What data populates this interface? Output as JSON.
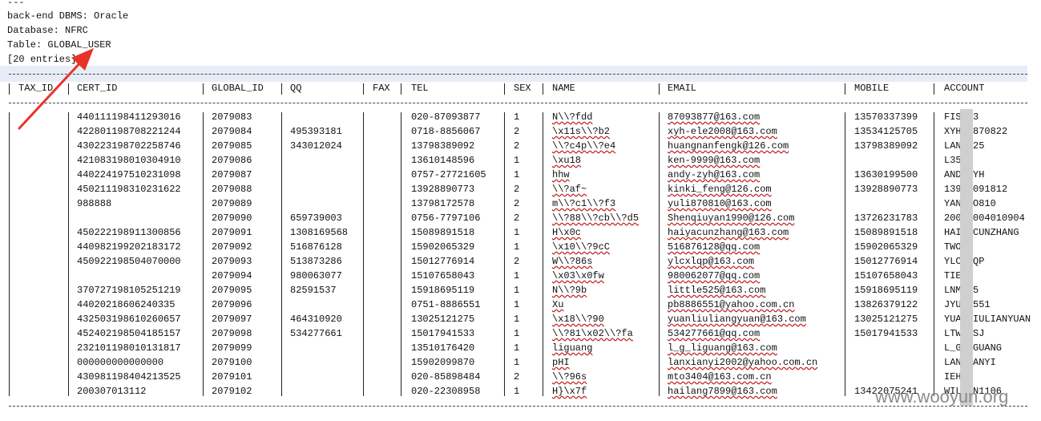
{
  "header": {
    "lines": [
      "---",
      "back-end DBMS: Oracle",
      "Database: NFRC",
      "Table: GLOBAL_USER",
      "[20 entries]"
    ]
  },
  "table": {
    "columns": [
      "TAX_ID",
      "CERT_ID",
      "GLOBAL_ID",
      "QQ",
      "FAX",
      "TEL",
      "SEX",
      "NAME",
      "EMAIL",
      "MOBILE",
      "ACCOUNT"
    ],
    "rows": [
      [
        "",
        "440111198411293016",
        "2079083",
        "",
        "",
        "020-87093877",
        "1",
        "N\\\\?fdd",
        "87093877@163.com",
        "13570337399",
        "FIS123"
      ],
      [
        "",
        "422801198708221244",
        "2079084",
        "495393181",
        "",
        "0718-8856067",
        "2",
        "\\x11s\\\\?b2",
        "xyh-ele2008@163.com",
        "13534125705",
        "XYH19870822"
      ],
      [
        "",
        "430223198702258746",
        "2079085",
        "343012024",
        "",
        "13798389092",
        "2",
        "\\\\?c4p\\\\?e4",
        "huangnanfengk@126.com",
        "13798389092",
        "LANC025"
      ],
      [
        "",
        "421083198010304910",
        "2079086",
        "",
        "",
        "13610148596",
        "1",
        "\\xu18",
        "ken-9999@163.com",
        "",
        "L3510"
      ],
      [
        "",
        "440224197510231098",
        "2079087",
        "",
        "",
        "0757-27721605",
        "1",
        "hhw",
        "andy-zyh@163.com",
        "13630199500",
        "ANDYZYH"
      ],
      [
        "",
        "450211198310231622",
        "2079088",
        "",
        "",
        "13928890773",
        "2",
        "\\\\?af~",
        "kinki_feng@126.com",
        "13928890773",
        "13911091812"
      ],
      [
        "",
        "988888",
        "2079089",
        "",
        "",
        "13798172578",
        "2",
        "m\\\\?c1\\\\?f3",
        "yuli870810@163.com",
        "",
        "YANGUO810"
      ],
      [
        "",
        "",
        "2079090",
        "659739003",
        "",
        "0756-7797106",
        "2",
        "\\\\?88\\\\?cb\\\\?d5",
        "Shenqiuyan1990@126.com",
        "13726231783",
        "20090004010904"
      ],
      [
        "",
        "450222198911300856",
        "2079091",
        "1308169568",
        "",
        "15089891518",
        "1",
        "H\\x0c",
        "haiyacunzhang@163.com",
        "15089891518",
        "HAIYACUNZHANG"
      ],
      [
        "",
        "440982199202183172",
        "2079092",
        "516876128",
        "",
        "15902065329",
        "1",
        "\\x10\\\\?9cC",
        "516876128@qq.com",
        "15902065329",
        "TWO28"
      ],
      [
        "",
        "450922198504070000",
        "2079093",
        "513873286",
        "",
        "15012776914",
        "2",
        "W\\\\?86s",
        "ylcxlqp@163.com",
        "15012776914",
        "YLCXLQP"
      ],
      [
        "",
        "",
        "2079094",
        "980063077",
        "",
        "15107658043",
        "1",
        "\\x03\\x0fw",
        "980062077@qq.com",
        "15107658043",
        "TIECH"
      ],
      [
        "",
        "370727198105251219",
        "2079095",
        "82591537",
        "",
        "15918695119",
        "1",
        "N\\\\?9b",
        "little525@163.com",
        "15918695119",
        "LNM525"
      ],
      [
        "",
        "44020218606240335",
        "2079096",
        "",
        "",
        "0751-8886551",
        "1",
        "Xu",
        "pb8886551@yahoo.com.cn",
        "13826379122",
        "JYU86551"
      ],
      [
        "",
        "432503198610260657",
        "2079097",
        "464310920",
        "",
        "13025121275",
        "1",
        "\\x18\\\\?90",
        "yuanliuliangyuan@163.com",
        "13025121275",
        "YUANLIULIANYUAN"
      ],
      [
        "",
        "452402198504185157",
        "2079098",
        "534277661",
        "",
        "15017941533",
        "1",
        "\\\\?81\\x02\\\\?fa",
        "534277661@qq.com",
        "15017941533",
        "LTWNPSJ"
      ],
      [
        "",
        "232101198010131817",
        "2079099",
        "",
        "",
        "13510176420",
        "1",
        "liguang",
        "l_g_liguang@163.com",
        "",
        "L_GLIGUANG"
      ],
      [
        "",
        "000000000000000",
        "2079100",
        "",
        "",
        "15902099870",
        "1",
        "pHI",
        "lanxianyi2002@yahoo.com.cn",
        "",
        "LANXIANYI"
      ],
      [
        "",
        "430981198404213525",
        "2079101",
        "",
        "",
        "020-85898484",
        "2",
        "\\\\?96s",
        "mto3404@163.com.cn",
        "",
        "IEH"
      ],
      [
        "",
        "200307013112",
        "2079102",
        "",
        "",
        "020-22308958",
        "1",
        "H}\\x7f",
        "hailang7899@163.com",
        "13422075241",
        "WILSON1106"
      ]
    ]
  },
  "watermark": "www.wooyun.org",
  "colors": {
    "highlight_row": "#e7edf7",
    "arrow": "#e8332a"
  }
}
